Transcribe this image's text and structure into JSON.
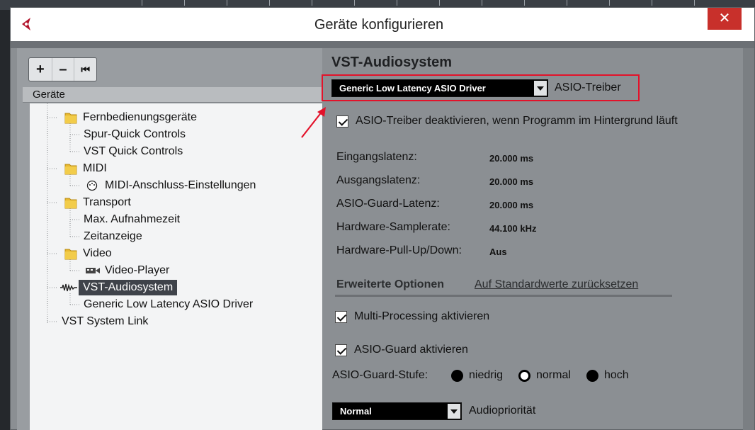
{
  "window": {
    "title": "Geräte konfigurieren",
    "close_symbol": "✕"
  },
  "toolbar": {
    "add": "+",
    "remove": "–",
    "reset": "⏮"
  },
  "tree": {
    "header": "Geräte",
    "items": [
      {
        "label": "Fernbedienungsgeräte"
      },
      {
        "label": "Spur-Quick Controls"
      },
      {
        "label": "VST Quick Controls"
      },
      {
        "label": "MIDI"
      },
      {
        "label": "MIDI-Anschluss-Einstellungen"
      },
      {
        "label": "Transport"
      },
      {
        "label": "Max. Aufnahmezeit"
      },
      {
        "label": "Zeitanzeige"
      },
      {
        "label": "Video"
      },
      {
        "label": "Video-Player"
      },
      {
        "label": "VST-Audiosystem"
      },
      {
        "label": "Generic Low Latency ASIO Driver"
      },
      {
        "label": "VST System Link"
      }
    ]
  },
  "main": {
    "title": "VST-Audiosystem",
    "driver_select": "Generic Low Latency ASIO Driver",
    "driver_label": "ASIO-Treiber",
    "deactivate_label": "ASIO-Treiber deaktivieren, wenn Programm im Hintergrund läuft",
    "info": [
      {
        "label": "Eingangslatenz:",
        "value": "20.000 ms"
      },
      {
        "label": "Ausgangslatenz:",
        "value": "20.000 ms"
      },
      {
        "label": "ASIO-Guard-Latenz:",
        "value": "20.000 ms"
      },
      {
        "label": "Hardware-Samplerate:",
        "value": "44.100 kHz"
      },
      {
        "label": "Hardware-Pull-Up/Down:",
        "value": "Aus"
      }
    ],
    "advanced_title": "Erweiterte Optionen",
    "reset_link": "Auf Standardwerte zurücksetzen",
    "multiprocessing_label": "Multi-Processing aktivieren",
    "asioguard_label": "ASIO-Guard aktivieren",
    "asioguard_stage_label": "ASIO-Guard-Stufe:",
    "stage_options": [
      "niedrig",
      "normal",
      "hoch"
    ],
    "stage_selected": "normal",
    "priority_select": "Normal",
    "priority_label": "Audiopriorität"
  },
  "colors": {
    "highlight": "#e3122a",
    "close": "#c8302b",
    "panel": "#8b8f93"
  }
}
